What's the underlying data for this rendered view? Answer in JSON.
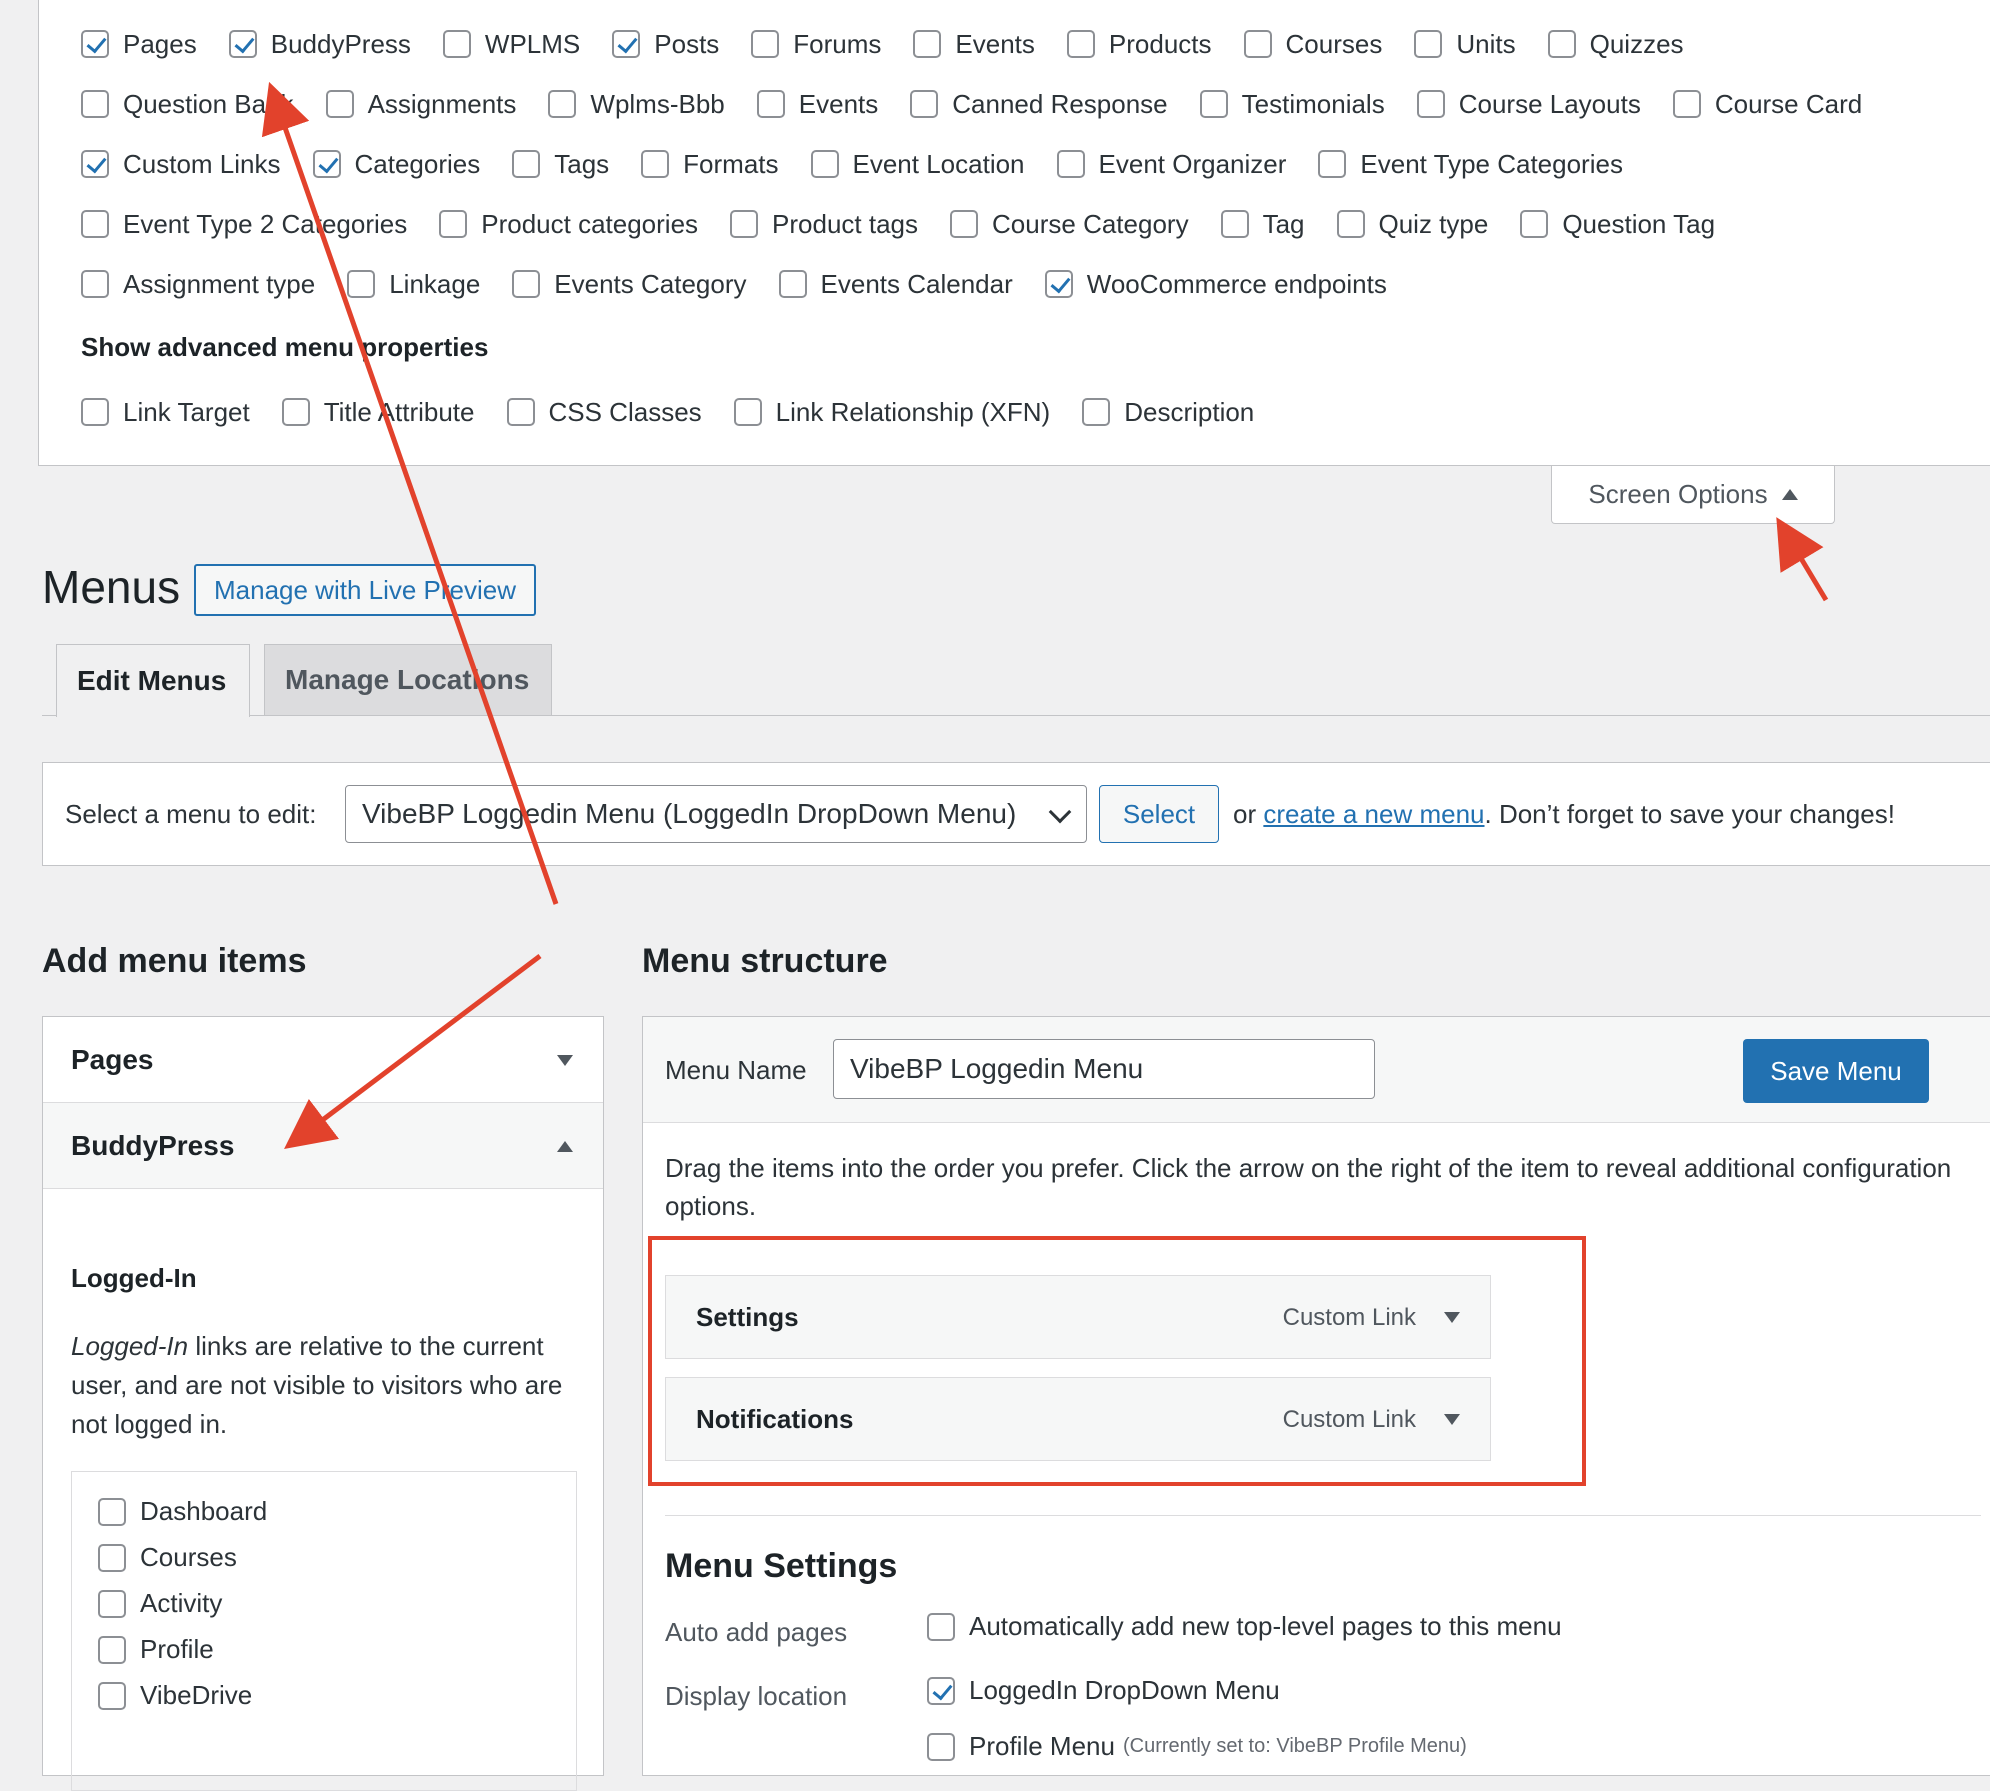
{
  "screen_options": {
    "rows": [
      [
        {
          "label": "Pages",
          "checked": true
        },
        {
          "label": "BuddyPress",
          "checked": true
        },
        {
          "label": "WPLMS",
          "checked": false
        },
        {
          "label": "Posts",
          "checked": true
        },
        {
          "label": "Forums",
          "checked": false
        },
        {
          "label": "Events",
          "checked": false
        },
        {
          "label": "Products",
          "checked": false
        },
        {
          "label": "Courses",
          "checked": false
        },
        {
          "label": "Units",
          "checked": false
        },
        {
          "label": "Quizzes",
          "checked": false
        }
      ],
      [
        {
          "label": "Question Bank",
          "checked": false
        },
        {
          "label": "Assignments",
          "checked": false
        },
        {
          "label": "Wplms-Bbb",
          "checked": false
        },
        {
          "label": "Events",
          "checked": false
        },
        {
          "label": "Canned Response",
          "checked": false
        },
        {
          "label": "Testimonials",
          "checked": false
        },
        {
          "label": "Course Layouts",
          "checked": false
        },
        {
          "label": "Course Card",
          "checked": false
        }
      ],
      [
        {
          "label": "Custom Links",
          "checked": true
        },
        {
          "label": "Categories",
          "checked": true
        },
        {
          "label": "Tags",
          "checked": false
        },
        {
          "label": "Formats",
          "checked": false
        },
        {
          "label": "Event Location",
          "checked": false
        },
        {
          "label": "Event Organizer",
          "checked": false
        },
        {
          "label": "Event Type Categories",
          "checked": false
        }
      ],
      [
        {
          "label": "Event Type 2 Categories",
          "checked": false
        },
        {
          "label": "Product categories",
          "checked": false
        },
        {
          "label": "Product tags",
          "checked": false
        },
        {
          "label": "Course Category",
          "checked": false
        },
        {
          "label": "Tag",
          "checked": false
        },
        {
          "label": "Quiz type",
          "checked": false
        },
        {
          "label": "Question Tag",
          "checked": false
        }
      ],
      [
        {
          "label": "Assignment type",
          "checked": false
        },
        {
          "label": "Linkage",
          "checked": false
        },
        {
          "label": "Events Category",
          "checked": false
        },
        {
          "label": "Events Calendar",
          "checked": false
        },
        {
          "label": "WooCommerce endpoints",
          "checked": true
        }
      ]
    ],
    "advanced_heading": "Show advanced menu properties",
    "advanced": [
      {
        "label": "Link Target",
        "checked": false
      },
      {
        "label": "Title Attribute",
        "checked": false
      },
      {
        "label": "CSS Classes",
        "checked": false
      },
      {
        "label": "Link Relationship (XFN)",
        "checked": false
      },
      {
        "label": "Description",
        "checked": false
      }
    ],
    "toggle_label": "Screen Options"
  },
  "header": {
    "title": "Menus",
    "live_preview_label": "Manage with Live Preview",
    "tabs": [
      "Edit Menus",
      "Manage Locations"
    ]
  },
  "select_bar": {
    "label": "Select a menu to edit:",
    "selected": "VibeBP Loggedin Menu (LoggedIn DropDown Menu)",
    "button": "Select",
    "prefix": "or",
    "create_link": "create a new menu",
    "suffix": ". Don’t forget to save your changes!"
  },
  "add_items": {
    "heading": "Add menu items",
    "sections": [
      "Pages",
      "BuddyPress"
    ],
    "subheading": "Logged-In",
    "desc_em": "Logged-In",
    "desc_rest": " links are relative to the current user, and are not visible to visitors who are not logged in.",
    "items": [
      "Dashboard",
      "Courses",
      "Activity",
      "Profile",
      "VibeDrive"
    ]
  },
  "structure": {
    "heading": "Menu structure",
    "name_label": "Menu Name",
    "name_value": "VibeBP Loggedin Menu",
    "save_label": "Save Menu",
    "help": "Drag the items into the order you prefer. Click the arrow on the right of the item to reveal additional configuration options.",
    "items": [
      {
        "title": "Settings",
        "type": "Custom Link"
      },
      {
        "title": "Notifications",
        "type": "Custom Link"
      }
    ],
    "settings_heading": "Menu Settings",
    "auto_add_label": "Auto add pages",
    "auto_add_option": "Automatically add new top-level pages to this menu",
    "display_label": "Display location",
    "locations": [
      {
        "label": "LoggedIn DropDown Menu",
        "checked": true,
        "note": ""
      },
      {
        "label": "Profile Menu",
        "checked": false,
        "note": "(Currently set to: VibeBP Profile Menu)"
      }
    ]
  },
  "colors": {
    "accent": "#2271b1",
    "annotation": "#e2422c"
  }
}
